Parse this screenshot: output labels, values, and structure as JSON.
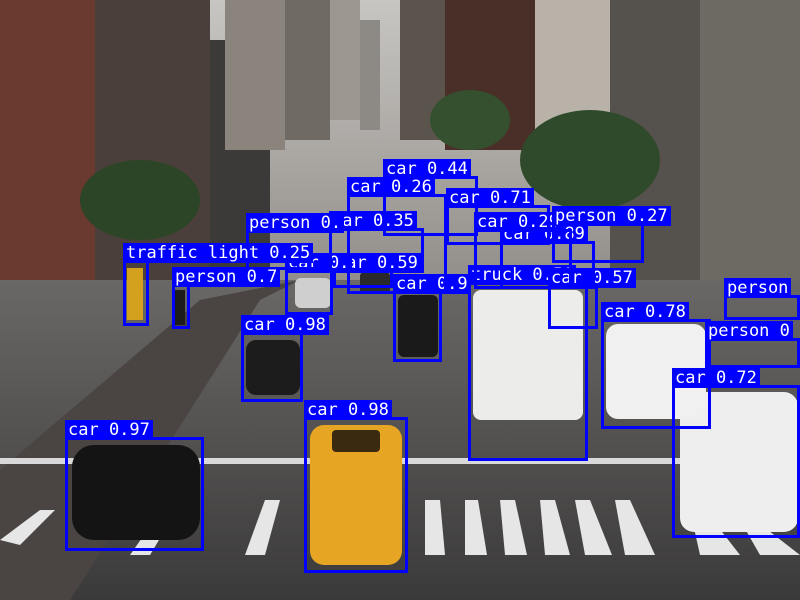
{
  "scene": "city street with object detections",
  "box_color": "#0000ff",
  "label_text_color": "#ffffff",
  "detections": [
    {
      "id": "car-097",
      "label": "car 0.97"
    },
    {
      "id": "car-098-taxi",
      "label": "car 0.98"
    },
    {
      "id": "car-098-left",
      "label": "car 0.98"
    },
    {
      "id": "car-072",
      "label": "car 0.72"
    },
    {
      "id": "car-078",
      "label": "car 0.78"
    },
    {
      "id": "truck-050",
      "label": "truck 0.50"
    },
    {
      "id": "car-057",
      "label": "car 0.57"
    },
    {
      "id": "car-center",
      "label": "car 0.9"
    },
    {
      "id": "car-044",
      "label": "car 0.44"
    },
    {
      "id": "car-026",
      "label": "car 0.26"
    },
    {
      "id": "car-035",
      "label": "car 0.35"
    },
    {
      "id": "car-089",
      "label": "car 0.89"
    },
    {
      "id": "car-029",
      "label": "car 0.29"
    },
    {
      "id": "car-071",
      "label": "car 0.71"
    },
    {
      "id": "car-059",
      "label": "car 0.59"
    },
    {
      "id": "car-far-left",
      "label": "car 0."
    },
    {
      "id": "person-027",
      "label": "person 0.27"
    },
    {
      "id": "person-mid",
      "label": "person 0."
    },
    {
      "id": "person-left",
      "label": "person 0.7"
    },
    {
      "id": "person-right",
      "label": "person 0"
    },
    {
      "id": "person-far-right",
      "label": "person"
    },
    {
      "id": "traffic-light-025",
      "label": "traffic light 0.25"
    }
  ]
}
